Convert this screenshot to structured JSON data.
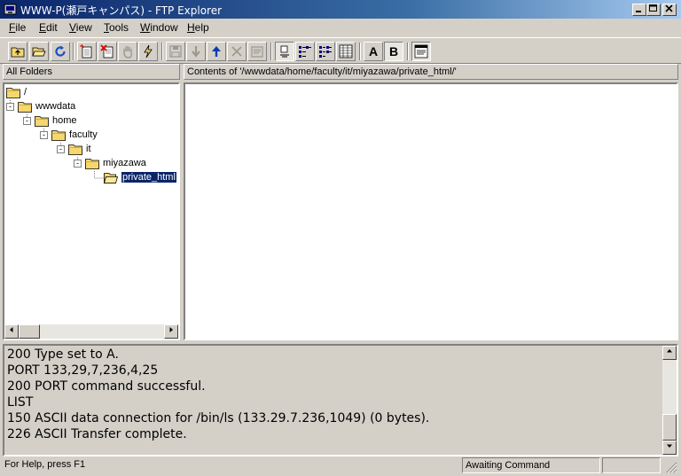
{
  "window": {
    "title": "WWW-P(瀬戸キャンパス) - FTP Explorer",
    "controls": [
      "minimize",
      "maximize",
      "close"
    ]
  },
  "menu": [
    {
      "label": "File",
      "accel": "F"
    },
    {
      "label": "Edit",
      "accel": "E"
    },
    {
      "label": "View",
      "accel": "V"
    },
    {
      "label": "Tools",
      "accel": "T"
    },
    {
      "label": "Window",
      "accel": "W"
    },
    {
      "label": "Help",
      "accel": "H"
    }
  ],
  "toolbar": {
    "buttons": [
      {
        "icon": "up-folder-icon",
        "enabled": true
      },
      {
        "icon": "open-folder-icon",
        "enabled": true
      },
      {
        "icon": "refresh-icon",
        "enabled": true
      },
      {
        "icon": "new-folder-icon",
        "enabled": true
      },
      {
        "icon": "delete-icon",
        "enabled": true
      },
      {
        "icon": "hand-icon",
        "enabled": false
      },
      {
        "icon": "connect-icon",
        "enabled": true
      },
      {
        "icon": "save-icon",
        "enabled": false
      },
      {
        "icon": "download-icon",
        "enabled": false
      },
      {
        "icon": "upload-icon",
        "enabled": true
      },
      {
        "icon": "cancel-icon",
        "enabled": false
      },
      {
        "icon": "properties-icon",
        "enabled": false
      },
      {
        "icon": "large-icons-view-icon",
        "enabled": true
      },
      {
        "icon": "small-icons-view-icon",
        "enabled": true
      },
      {
        "icon": "list-view-icon",
        "enabled": true
      },
      {
        "icon": "details-view-icon",
        "enabled": true
      },
      {
        "label": "A",
        "enabled": true
      },
      {
        "label": "B",
        "enabled": true
      },
      {
        "icon": "log-window-icon",
        "enabled": true
      }
    ]
  },
  "left_pane": {
    "header": "All Folders",
    "tree": [
      {
        "label": "/",
        "depth": 0,
        "expander": ""
      },
      {
        "label": "wwwdata",
        "depth": 1,
        "expander": "-"
      },
      {
        "label": "home",
        "depth": 2,
        "expander": "-"
      },
      {
        "label": "faculty",
        "depth": 3,
        "expander": "-"
      },
      {
        "label": "it",
        "depth": 4,
        "expander": "-"
      },
      {
        "label": "miyazawa",
        "depth": 5,
        "expander": "-"
      },
      {
        "label": "private_html",
        "depth": 6,
        "expander": "",
        "selected": true
      }
    ]
  },
  "right_pane": {
    "header": "Contents of '/wwwdata/home/faculty/it/miyazawa/private_html/'"
  },
  "log": {
    "lines": [
      "200 Type set to A.",
      "PORT 133,29,7,236,4,25",
      "200 PORT command successful.",
      "LIST",
      "150 ASCII data connection for /bin/ls (133.29.7.236,1049) (0 bytes).",
      "226 ASCII Transfer complete."
    ]
  },
  "status": {
    "help": "For Help, press F1",
    "state": "Awaiting Command",
    "extra": ""
  },
  "colors": {
    "title_start": "#0a246a",
    "title_end": "#a6caf0",
    "face": "#d4d0c8",
    "selection": "#0a246a",
    "folder": "#f5d76e"
  }
}
